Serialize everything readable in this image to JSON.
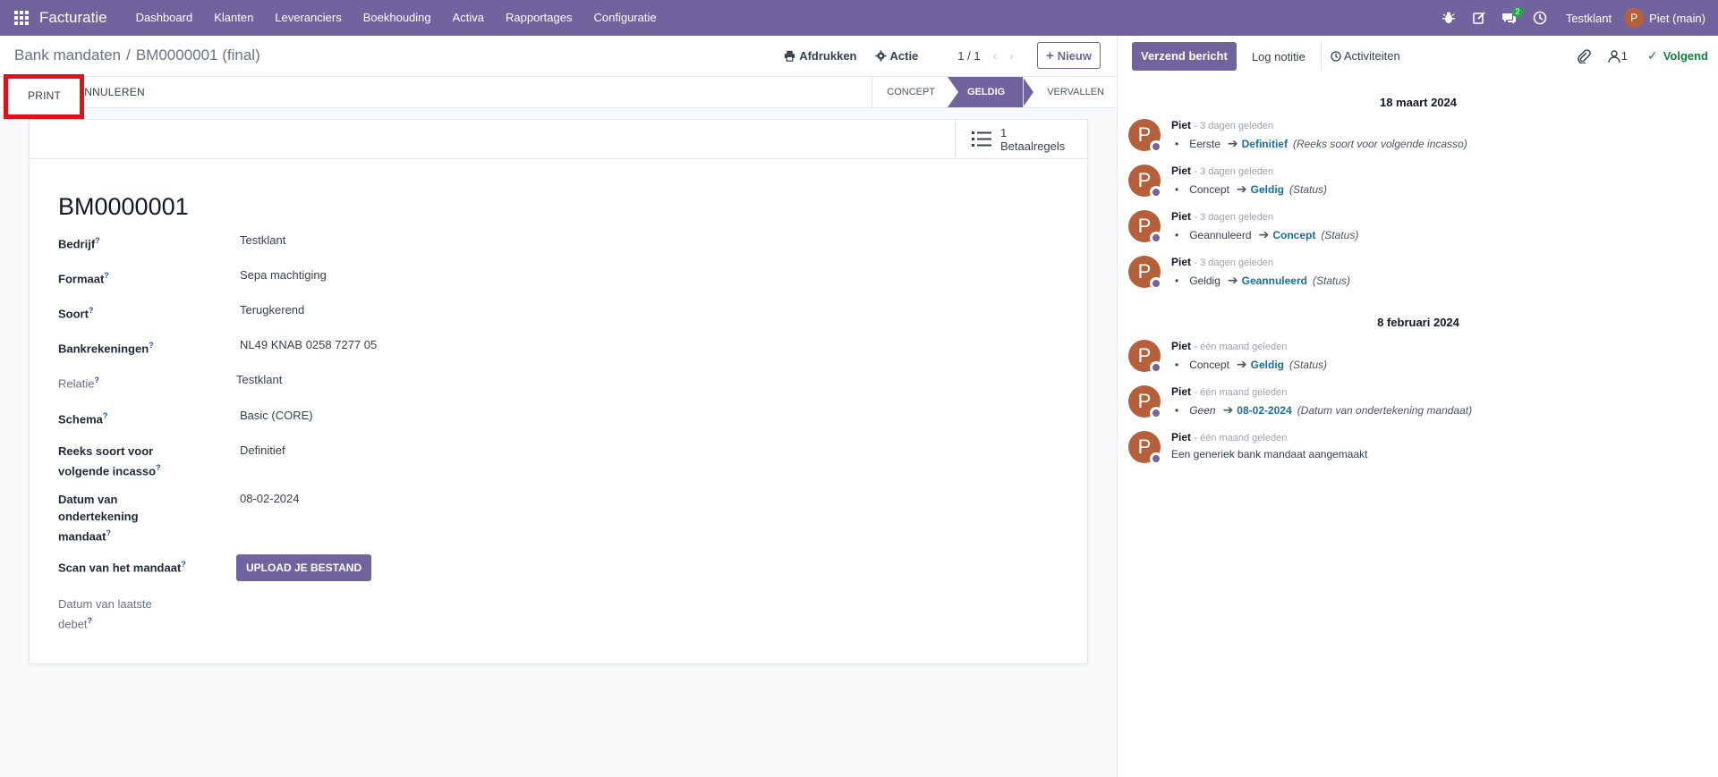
{
  "navbar": {
    "app_name": "Facturatie",
    "menu": [
      "Dashboard",
      "Klanten",
      "Leveranciers",
      "Boekhouding",
      "Activa",
      "Rapportages",
      "Configuratie"
    ],
    "chat_badge": "2",
    "company": "Testklant",
    "user_initial": "P",
    "user_name": "Piet (main)"
  },
  "control": {
    "breadcrumb_parent": "Bank mandaten",
    "breadcrumb_sep": "/",
    "breadcrumb_current": "BM0000001 (final)",
    "print_label": "Afdrukken",
    "action_label": "Actie",
    "pager": "1 / 1",
    "new_label": "Nieuw"
  },
  "statusbar": {
    "print_label": "PRINT",
    "cancel_label": "ANNULEREN",
    "stages": [
      "CONCEPT",
      "GELDIG",
      "VERVALLEN"
    ],
    "active_stage": "GELDIG"
  },
  "form": {
    "smart_button": {
      "count": "1",
      "label": "Betaalregels"
    },
    "title": "BM0000001",
    "fields": [
      {
        "label": "Bedrijf",
        "value": "Testklant"
      },
      {
        "label": "Formaat",
        "value": "Sepa machtiging"
      },
      {
        "label": "Soort",
        "value": "Terugkerend"
      },
      {
        "label": "Bankrekeningen",
        "value": "NL49 KNAB 0258 7277 05"
      },
      {
        "label": "Relatie",
        "value": "Testklant"
      },
      {
        "label": "Schema",
        "value": "Basic (CORE)"
      },
      {
        "label": "Reeks soort voor volgende incasso",
        "value": "Definitief"
      },
      {
        "label": "Datum van ondertekening mandaat",
        "value": "08-02-2024"
      },
      {
        "label": "Scan van het mandaat",
        "value": ""
      },
      {
        "label": "Datum van laatste debet",
        "value": ""
      }
    ],
    "help_mark": "?",
    "upload_label": "UPLOAD JE BESTAND"
  },
  "chatter": {
    "send_label": "Verzend bericht",
    "log_label": "Log notitie",
    "activities_label": "Activiteiten",
    "followers_count": "1",
    "follow_label": "Volgend",
    "groups": [
      {
        "date": "18 maart 2024",
        "messages": [
          {
            "author": "Piet",
            "ago": "- 3 dagen geleden",
            "old": "Eerste",
            "new": "Definitief",
            "field": "(Reeks soort voor volgende incasso)"
          },
          {
            "author": "Piet",
            "ago": "- 3 dagen geleden",
            "old": "Concept",
            "new": "Geldig",
            "field": "(Status)"
          },
          {
            "author": "Piet",
            "ago": "- 3 dagen geleden",
            "old": "Geannuleerd",
            "new": "Concept",
            "field": "(Status)"
          },
          {
            "author": "Piet",
            "ago": "- 3 dagen geleden",
            "old": "Geldig",
            "new": "Geannuleerd",
            "field": "(Status)"
          }
        ]
      },
      {
        "date": "8 februari 2024",
        "messages": [
          {
            "author": "Piet",
            "ago": "- één maand geleden",
            "old": "Concept",
            "new": "Geldig",
            "field": "(Status)"
          },
          {
            "author": "Piet",
            "ago": "- één maand geleden",
            "old": "Geen",
            "new": "08-02-2024",
            "field": "(Datum van ondertekening mandaat)"
          },
          {
            "author": "Piet",
            "ago": "- één maand geleden",
            "text": "Een generiek bank mandaat aangemaakt"
          }
        ]
      }
    ]
  },
  "colors": {
    "brand": "#71639e",
    "link": "#1a6e9e",
    "follow": "#15803d",
    "avatar": "#b5603b",
    "highlight_box": "#e3101c"
  }
}
